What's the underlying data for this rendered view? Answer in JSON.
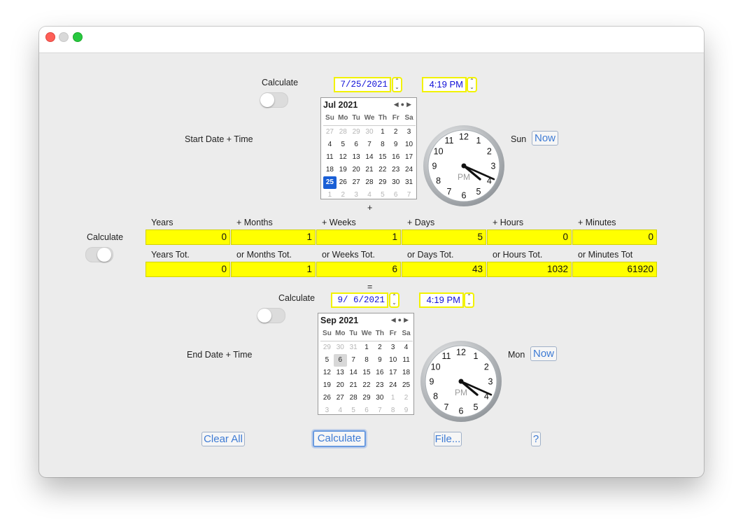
{
  "start": {
    "calc_label": "Calculate",
    "row_label": "Start Date + Time",
    "date_value": "7/25/2021",
    "time_value": "4:19 PM",
    "weekday": "Sun",
    "now_label": "Now",
    "calendar": {
      "title": "Jul 2021",
      "dow": [
        "Su",
        "Mo",
        "Tu",
        "We",
        "Th",
        "Fr",
        "Sa"
      ],
      "days": [
        "27",
        "28",
        "29",
        "30",
        "1",
        "2",
        "3",
        "4",
        "5",
        "6",
        "7",
        "8",
        "9",
        "10",
        "11",
        "12",
        "13",
        "14",
        "15",
        "16",
        "17",
        "18",
        "19",
        "20",
        "21",
        "22",
        "23",
        "24",
        "25",
        "26",
        "27",
        "28",
        "29",
        "30",
        "31",
        "1",
        "2",
        "3",
        "4",
        "5",
        "6",
        "7"
      ],
      "other_month": [
        0,
        1,
        2,
        3,
        35,
        36,
        37,
        38,
        39,
        40,
        41
      ],
      "selected_index": 28
    },
    "clock": {
      "numbers": [
        "12",
        "1",
        "2",
        "3",
        "4",
        "5",
        "6",
        "7",
        "8",
        "9",
        "10",
        "11"
      ],
      "ampm": "PM",
      "hour": 4,
      "minute": 19
    }
  },
  "plus_label": "+",
  "equals_label": "=",
  "middle": {
    "calc_label": "Calculate",
    "headers": [
      "Years",
      "+ Months",
      "+ Weeks",
      "+ Days",
      "+ Hours",
      "+ Minutes"
    ],
    "values": [
      "0",
      "1",
      "1",
      "5",
      "0",
      "0"
    ],
    "tot_headers": [
      "Years Tot.",
      "or Months Tot.",
      "or Weeks Tot.",
      "or Days Tot.",
      "or Hours Tot.",
      "or Minutes Tot"
    ],
    "tot_values": [
      "0",
      "1",
      "6",
      "43",
      "1032",
      "61920"
    ]
  },
  "end": {
    "calc_label": "Calculate",
    "row_label": "End Date + Time",
    "date_value": "9/ 6/2021",
    "time_value": "4:19 PM",
    "weekday": "Mon",
    "now_label": "Now",
    "calendar": {
      "title": "Sep 2021",
      "dow": [
        "Su",
        "Mo",
        "Tu",
        "We",
        "Th",
        "Fr",
        "Sa"
      ],
      "days": [
        "29",
        "30",
        "31",
        "1",
        "2",
        "3",
        "4",
        "5",
        "6",
        "7",
        "8",
        "9",
        "10",
        "11",
        "12",
        "13",
        "14",
        "15",
        "16",
        "17",
        "18",
        "19",
        "20",
        "21",
        "22",
        "23",
        "24",
        "25",
        "26",
        "27",
        "28",
        "29",
        "30",
        "1",
        "2",
        "3",
        "4",
        "5",
        "6",
        "7",
        "8",
        "9"
      ],
      "other_month": [
        0,
        1,
        2,
        33,
        34,
        35,
        36,
        37,
        38,
        39,
        40,
        41
      ],
      "today_index": 8
    },
    "clock": {
      "numbers": [
        "12",
        "1",
        "2",
        "3",
        "4",
        "5",
        "6",
        "7",
        "8",
        "9",
        "10",
        "11"
      ],
      "ampm": "PM",
      "hour": 4,
      "minute": 19
    }
  },
  "buttons": {
    "clear_all": "Clear All",
    "calculate": "Calculate",
    "file": "File...",
    "help": "?"
  }
}
